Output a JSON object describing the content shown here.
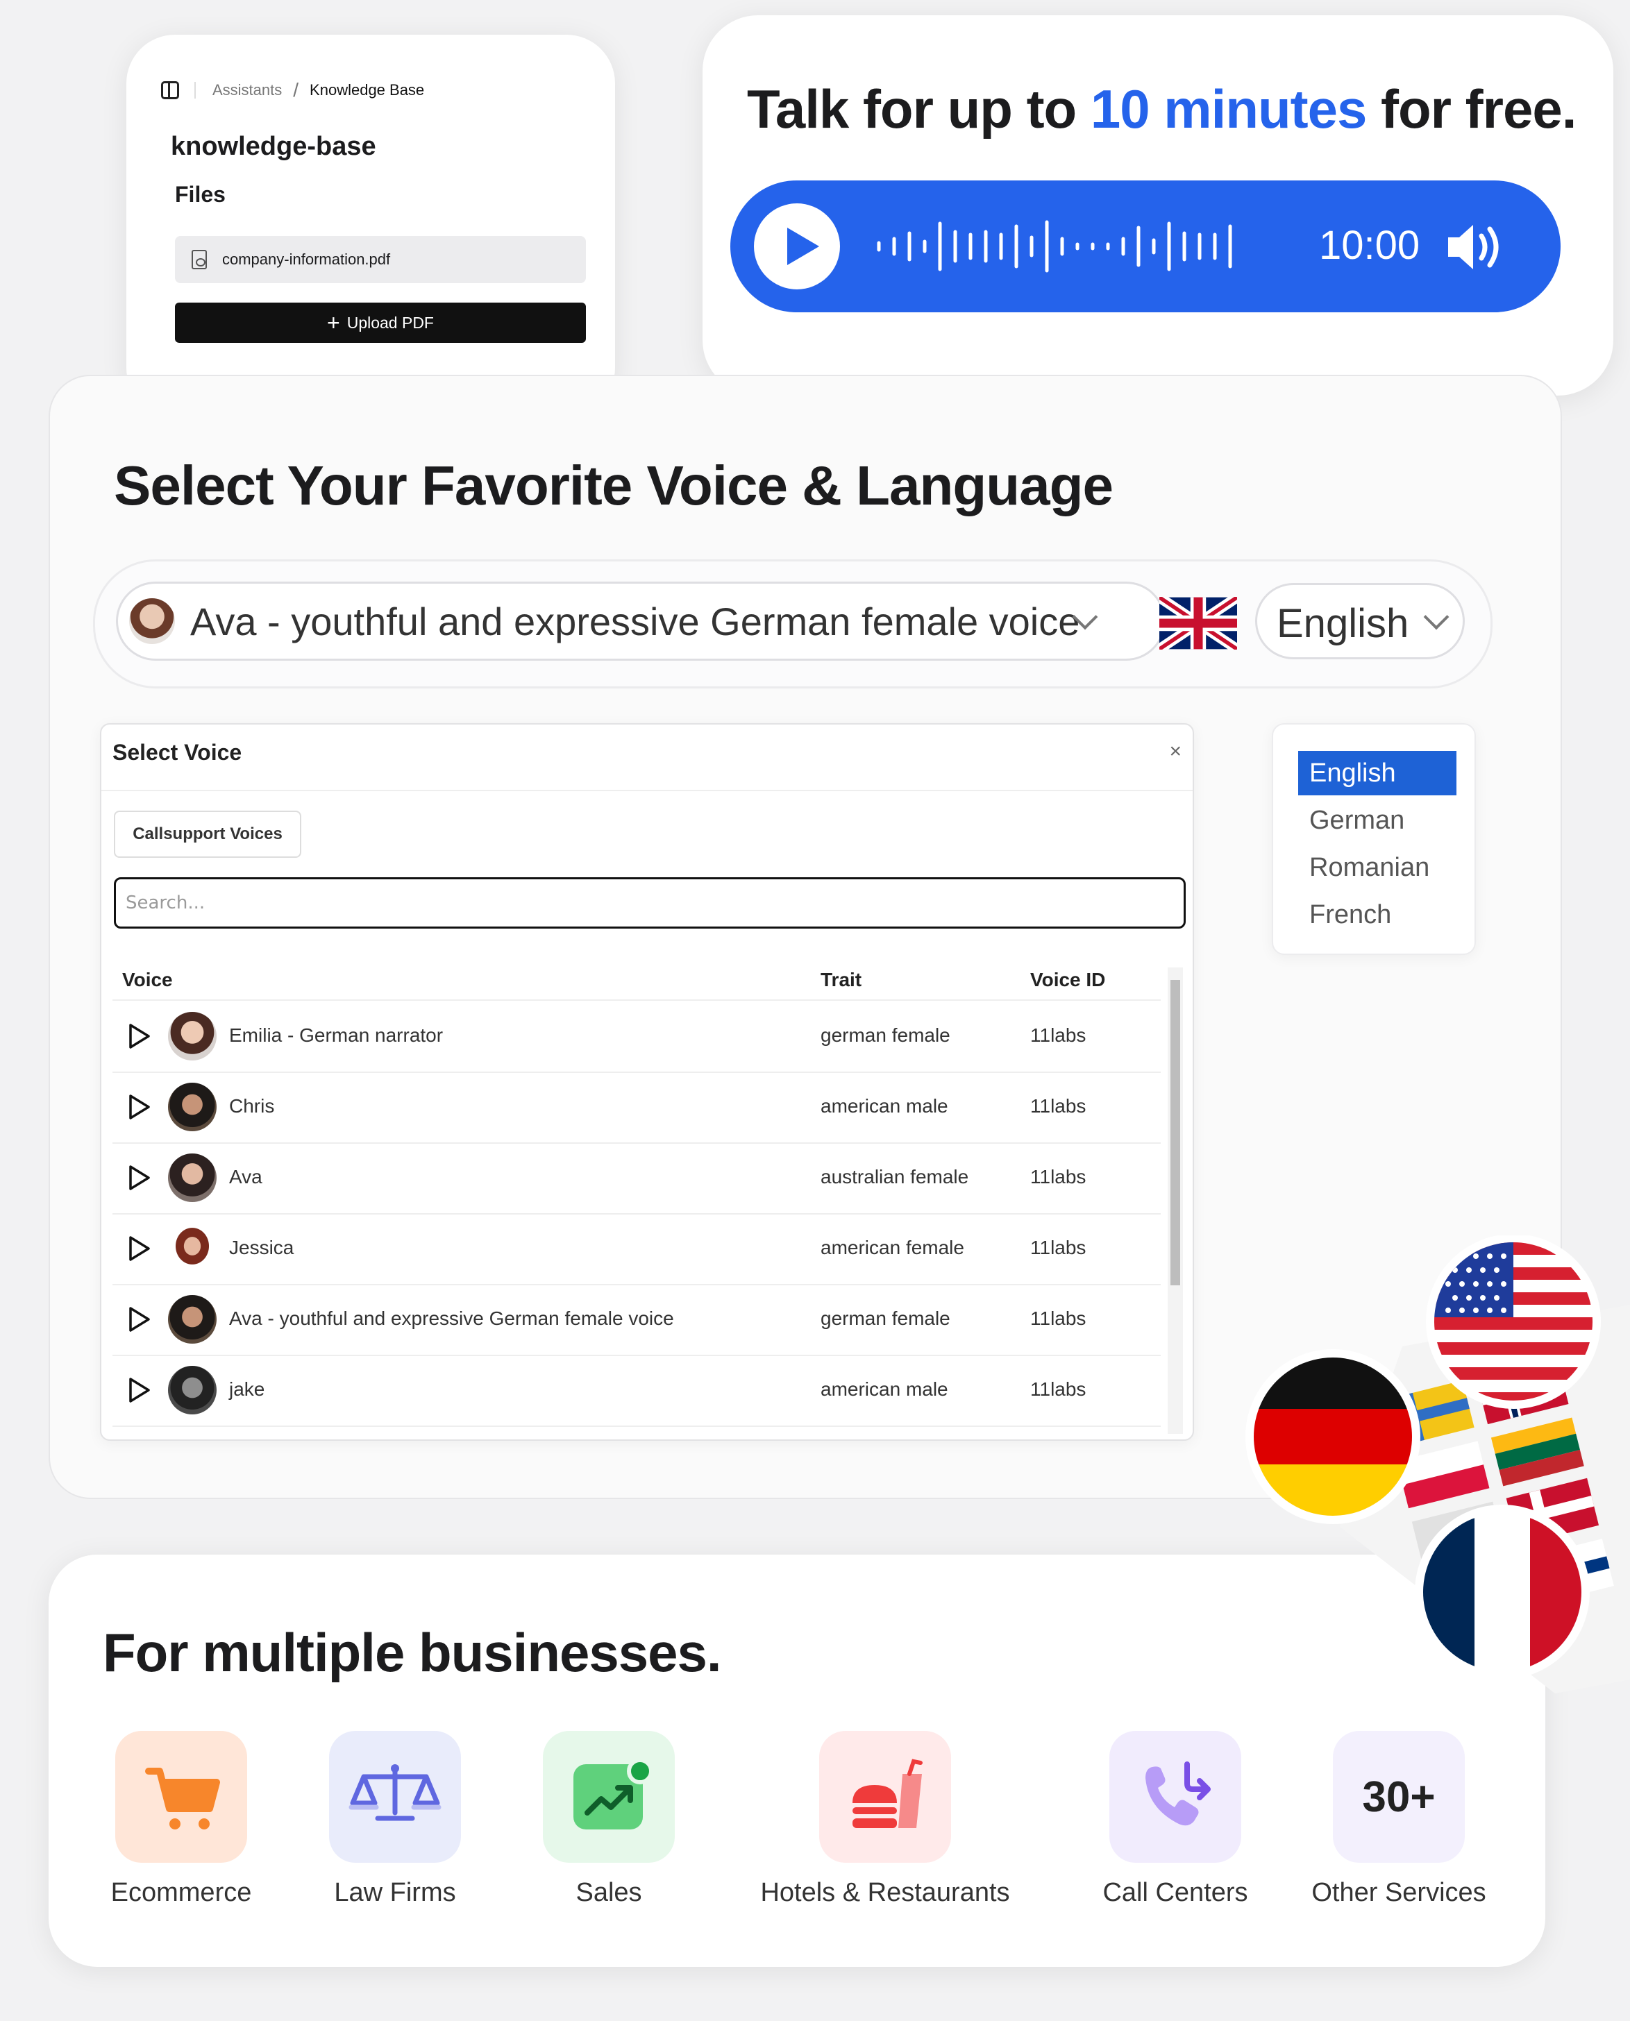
{
  "knowledge_base": {
    "breadcrumb_root": "Assistants",
    "breadcrumb_sep": "/",
    "breadcrumb_current": "Knowledge Base",
    "title": "knowledge-base",
    "files_heading": "Files",
    "file_name": "company-information.pdf",
    "upload_icon": "+",
    "upload_label": "Upload PDF"
  },
  "talk": {
    "headline_before": "Talk for up to ",
    "headline_accent": "10 minutes",
    "headline_after": " for free.",
    "timer": "10:00",
    "accent_color": "#2563eb"
  },
  "voice_section": {
    "title": "Select Your Favorite Voice & Language",
    "selected_voice": "Ava - youthful and expressive German female voice",
    "selected_language": "English",
    "modal": {
      "title": "Select Voice",
      "close": "×",
      "tab": "Callsupport Voices",
      "search_placeholder": "Search...",
      "columns": {
        "voice": "Voice",
        "trait": "Trait",
        "voice_id": "Voice ID"
      },
      "rows": [
        {
          "name": "Emilia - German narrator",
          "trait": "german  female",
          "voice_id": "11labs"
        },
        {
          "name": "Chris",
          "trait": "american  male",
          "voice_id": "11labs"
        },
        {
          "name": "Ava",
          "trait": "australian  female",
          "voice_id": "11labs"
        },
        {
          "name": "Jessica",
          "trait": "american  female",
          "voice_id": "11labs"
        },
        {
          "name": "Ava - youthful and expressive German female voice",
          "trait": "german  female",
          "voice_id": "11labs"
        },
        {
          "name": "jake",
          "trait": "american  male",
          "voice_id": "11labs"
        }
      ]
    },
    "languages": [
      "English",
      "German",
      "Romanian",
      "French"
    ],
    "selected_language_index": 0
  },
  "businesses": {
    "title": "For multiple businesses.",
    "items": [
      {
        "label": "Ecommerce",
        "icon": "cart-icon"
      },
      {
        "label": "Law Firms",
        "icon": "scales-icon"
      },
      {
        "label": "Sales",
        "icon": "trend-icon"
      },
      {
        "label": "Hotels & Restaurants",
        "icon": "food-icon"
      },
      {
        "label": "Call Centers",
        "icon": "phone-icon"
      },
      {
        "label": "Other Services",
        "icon": "",
        "badge": "30+"
      }
    ]
  }
}
